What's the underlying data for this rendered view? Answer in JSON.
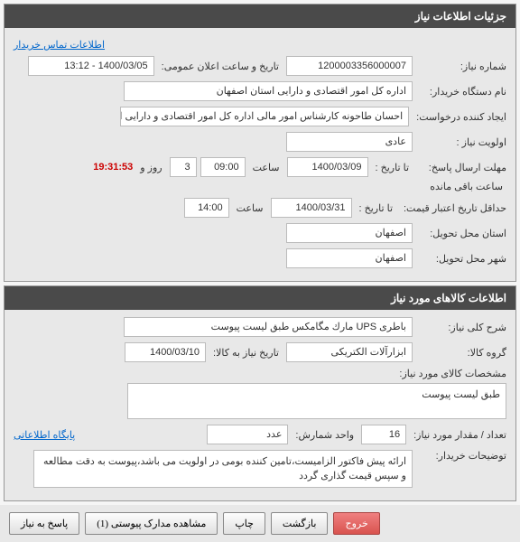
{
  "header1_title": "جزئیات اطلاعات نیاز",
  "contact_link": "اطلاعات تماس خریدار",
  "need_number_label": "شماره نیاز:",
  "need_number": "1200003356000007",
  "announce_date_label": "تاریخ و ساعت اعلان عمومی:",
  "announce_date": "1400/03/05 - 13:12",
  "buyer_org_label": "نام دستگاه خریدار:",
  "buyer_org": "اداره کل امور اقتصادی و دارایی استان اصفهان",
  "creator_label": "ایجاد کننده درخواست:",
  "creator": "احسان طاحونه کارشناس امور مالی اداره کل امور اقتصادی و دارایی استان اصفهان",
  "priority_label": "اولویت نیاز :",
  "priority": "عادی",
  "response_deadline_label": "مهلت ارسال پاسخ:",
  "to_date_label": "تا تاریخ :",
  "response_date": "1400/03/09",
  "time_label": "ساعت",
  "response_time": "09:00",
  "days_value": "3",
  "days_label": "روز و",
  "countdown": "19:31:53",
  "remaining_label": "ساعت باقی مانده",
  "price_validity_label": "حداقل تاریخ اعتبار قیمت:",
  "price_validity_to_label": "تا تاریخ :",
  "price_validity_date": "1400/03/31",
  "price_validity_time": "14:00",
  "delivery_province_label": "استان محل تحویل:",
  "delivery_province": "اصفهان",
  "delivery_city_label": "شهر محل تحویل:",
  "delivery_city": "اصفهان",
  "header2_title": "اطلاعات کالاهای مورد نیاز",
  "item_desc_label": "شرح کلی نیاز:",
  "item_desc": "باطری UPS مارك مگامکس طبق لیست پیوست",
  "item_group_label": "گروه کالا:",
  "item_group": "ابزارآلات الکتریکی",
  "need_date_label": "تاریخ نیاز به کالا:",
  "need_date": "1400/03/10",
  "item_spec_label": "مشخصات کالای مورد نیاز:",
  "item_spec": "طبق لیست پیوست",
  "qty_label": "تعداد / مقدار مورد نیاز:",
  "qty": "16",
  "unit_label": "واحد شمارش:",
  "unit": "عدد",
  "ref_link": "پایگاه اطلاعاتی",
  "buyer_notes_label": "توضیحات خریدار:",
  "buyer_notes": "ارائه پیش فاکتور الزامیست،تامین کننده بومی در اولویت می باشد،پیوست به دقت مطالعه و سپس قیمت گذاری گردد",
  "btn_respond": "پاسخ به نیاز",
  "btn_attachments": "مشاهده مدارک پیوستی (1)",
  "btn_print": "چاپ",
  "btn_back": "بازگشت",
  "btn_exit": "خروج"
}
